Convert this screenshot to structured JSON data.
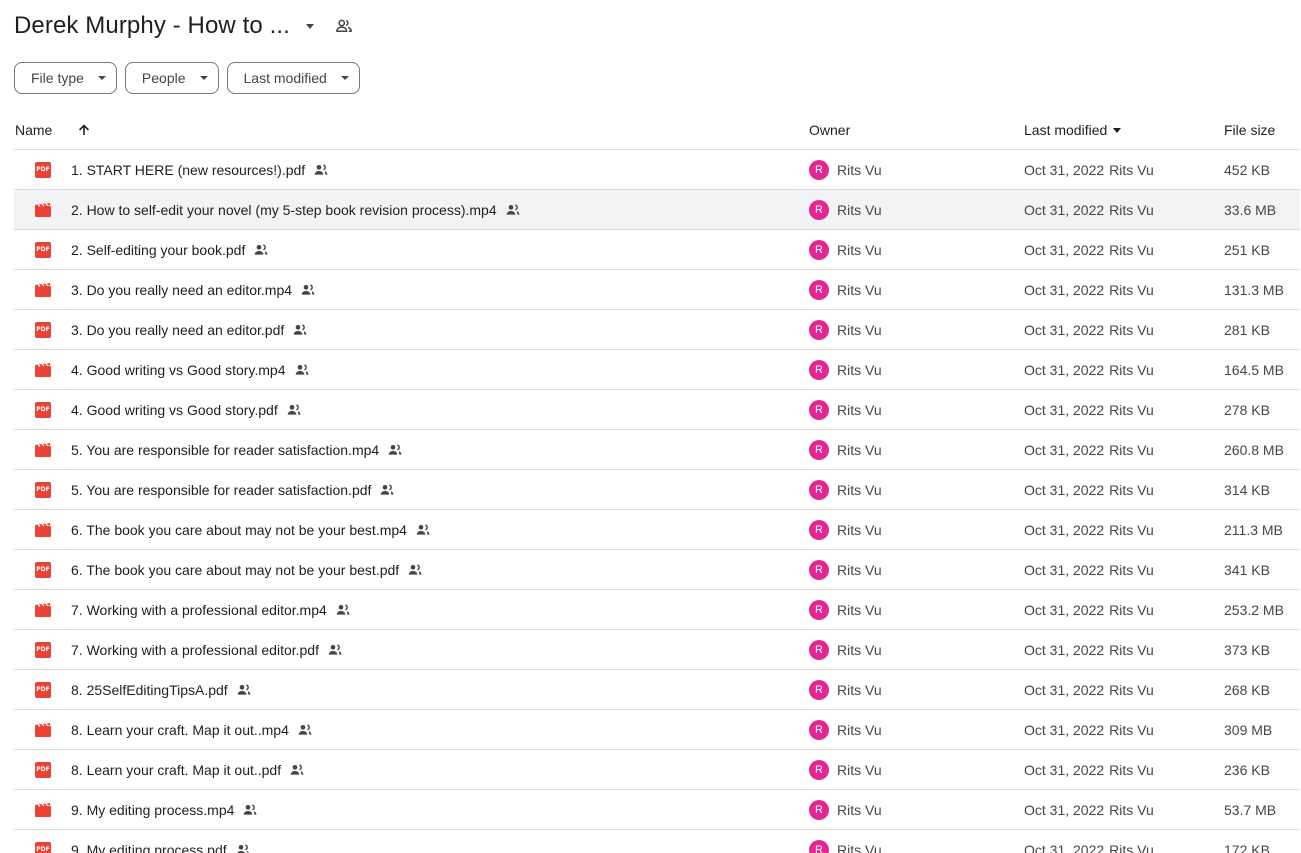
{
  "header": {
    "title": "Derek Murphy - How to ...",
    "caret_icon": "arrow-drop-down-icon",
    "shared_icon": "people-icon"
  },
  "filters": [
    {
      "label": "File type"
    },
    {
      "label": "People"
    },
    {
      "label": "Last modified"
    }
  ],
  "columns": {
    "name": "Name",
    "owner": "Owner",
    "last_modified": "Last modified",
    "file_size": "File size"
  },
  "colors": {
    "avatar": "#e52592",
    "pdf": "#ea4335",
    "video": "#ea4335",
    "selected_row": "#f1f3f4"
  },
  "files": [
    {
      "type": "pdf",
      "name": "1. START HERE (new resources!).pdf",
      "owner_initial": "R",
      "owner": "Rits Vu",
      "modified": "Oct 31, 2022",
      "modified_by": "Rits Vu",
      "size": "452 KB",
      "selected": false
    },
    {
      "type": "video",
      "name": "2. How to self-edit your novel (my 5-step book revision process).mp4",
      "owner_initial": "R",
      "owner": "Rits Vu",
      "modified": "Oct 31, 2022",
      "modified_by": "Rits Vu",
      "size": "33.6 MB",
      "selected": true
    },
    {
      "type": "pdf",
      "name": "2. Self-editing your book.pdf",
      "owner_initial": "R",
      "owner": "Rits Vu",
      "modified": "Oct 31, 2022",
      "modified_by": "Rits Vu",
      "size": "251 KB",
      "selected": false
    },
    {
      "type": "video",
      "name": "3. Do you really need an editor.mp4",
      "owner_initial": "R",
      "owner": "Rits Vu",
      "modified": "Oct 31, 2022",
      "modified_by": "Rits Vu",
      "size": "131.3 MB",
      "selected": false
    },
    {
      "type": "pdf",
      "name": "3. Do you really need an editor.pdf",
      "owner_initial": "R",
      "owner": "Rits Vu",
      "modified": "Oct 31, 2022",
      "modified_by": "Rits Vu",
      "size": "281 KB",
      "selected": false
    },
    {
      "type": "video",
      "name": "4. Good writing vs Good story.mp4",
      "owner_initial": "R",
      "owner": "Rits Vu",
      "modified": "Oct 31, 2022",
      "modified_by": "Rits Vu",
      "size": "164.5 MB",
      "selected": false
    },
    {
      "type": "pdf",
      "name": "4. Good writing vs Good story.pdf",
      "owner_initial": "R",
      "owner": "Rits Vu",
      "modified": "Oct 31, 2022",
      "modified_by": "Rits Vu",
      "size": "278 KB",
      "selected": false
    },
    {
      "type": "video",
      "name": "5. You are responsible for reader satisfaction.mp4",
      "owner_initial": "R",
      "owner": "Rits Vu",
      "modified": "Oct 31, 2022",
      "modified_by": "Rits Vu",
      "size": "260.8 MB",
      "selected": false
    },
    {
      "type": "pdf",
      "name": "5. You are responsible for reader satisfaction.pdf",
      "owner_initial": "R",
      "owner": "Rits Vu",
      "modified": "Oct 31, 2022",
      "modified_by": "Rits Vu",
      "size": "314 KB",
      "selected": false
    },
    {
      "type": "video",
      "name": "6. The book you care about may not be your best.mp4",
      "owner_initial": "R",
      "owner": "Rits Vu",
      "modified": "Oct 31, 2022",
      "modified_by": "Rits Vu",
      "size": "211.3 MB",
      "selected": false
    },
    {
      "type": "pdf",
      "name": "6. The book you care about may not be your best.pdf",
      "owner_initial": "R",
      "owner": "Rits Vu",
      "modified": "Oct 31, 2022",
      "modified_by": "Rits Vu",
      "size": "341 KB",
      "selected": false
    },
    {
      "type": "video",
      "name": "7. Working with a professional editor.mp4",
      "owner_initial": "R",
      "owner": "Rits Vu",
      "modified": "Oct 31, 2022",
      "modified_by": "Rits Vu",
      "size": "253.2 MB",
      "selected": false
    },
    {
      "type": "pdf",
      "name": "7. Working with a professional editor.pdf",
      "owner_initial": "R",
      "owner": "Rits Vu",
      "modified": "Oct 31, 2022",
      "modified_by": "Rits Vu",
      "size": "373 KB",
      "selected": false
    },
    {
      "type": "pdf",
      "name": "8. 25SelfEditingTipsA.pdf",
      "owner_initial": "R",
      "owner": "Rits Vu",
      "modified": "Oct 31, 2022",
      "modified_by": "Rits Vu",
      "size": "268 KB",
      "selected": false
    },
    {
      "type": "video",
      "name": "8. Learn your craft. Map it out..mp4",
      "owner_initial": "R",
      "owner": "Rits Vu",
      "modified": "Oct 31, 2022",
      "modified_by": "Rits Vu",
      "size": "309 MB",
      "selected": false
    },
    {
      "type": "pdf",
      "name": "8. Learn your craft. Map it out..pdf",
      "owner_initial": "R",
      "owner": "Rits Vu",
      "modified": "Oct 31, 2022",
      "modified_by": "Rits Vu",
      "size": "236 KB",
      "selected": false
    },
    {
      "type": "video",
      "name": "9. My editing process.mp4",
      "owner_initial": "R",
      "owner": "Rits Vu",
      "modified": "Oct 31, 2022",
      "modified_by": "Rits Vu",
      "size": "53.7 MB",
      "selected": false
    },
    {
      "type": "pdf",
      "name": "9. My editing process.pdf",
      "owner_initial": "R",
      "owner": "Rits Vu",
      "modified": "Oct 31, 2022",
      "modified_by": "Rits Vu",
      "size": "172 KB",
      "selected": false
    }
  ]
}
